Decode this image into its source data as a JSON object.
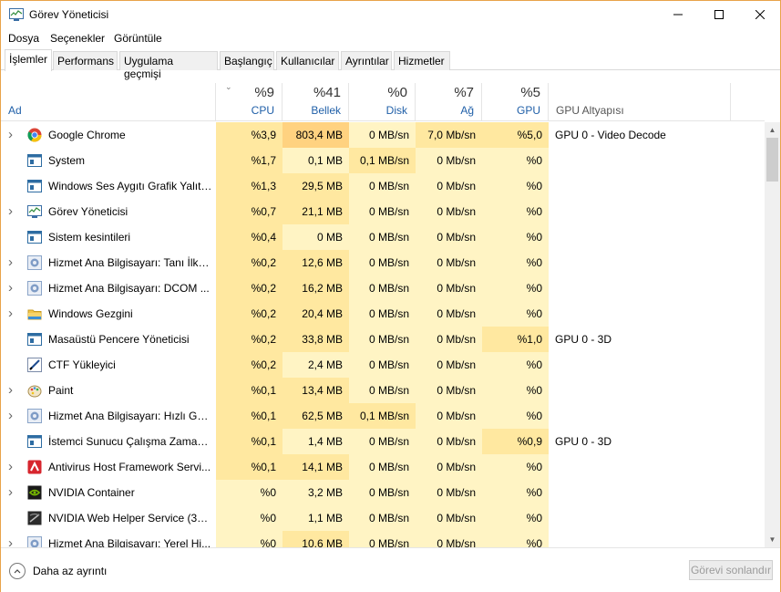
{
  "window": {
    "title": "Görev Yöneticisi"
  },
  "menu": [
    "Dosya",
    "Seçenekler",
    "Görüntüle"
  ],
  "tabs": [
    "İşlemler",
    "Performans",
    "Uygulama geçmişi",
    "Başlangıç",
    "Kullanıcılar",
    "Ayrıntılar",
    "Hizmetler"
  ],
  "header": {
    "name_label": "Ad",
    "cpu": {
      "pct": "%9",
      "label": "CPU"
    },
    "memory": {
      "pct": "%41",
      "label": "Bellek"
    },
    "disk": {
      "pct": "%0",
      "label": "Disk"
    },
    "network": {
      "pct": "%7",
      "label": "Ağ"
    },
    "gpu": {
      "pct": "%5",
      "label": "GPU"
    },
    "gpu_engine_label": "GPU Altyapısı"
  },
  "colors": {
    "heat_light": "#fff4c4",
    "heat_medium": "#ffe8a0",
    "heat_strong": "#ffd280",
    "link_blue": "#1f5fa8"
  },
  "processes": [
    {
      "name": "Google Chrome",
      "icon": "chrome-icon",
      "expandable": true,
      "cpu": "%3,9",
      "mem": "803,4 MB",
      "disk": "0 MB/sn",
      "net": "7,0 Mb/sn",
      "gpu": "%5,0",
      "engine": "GPU 0 - Video Decode"
    },
    {
      "name": "System",
      "icon": "system-window-icon",
      "expandable": false,
      "cpu": "%1,7",
      "mem": "0,1 MB",
      "disk": "0,1 MB/sn",
      "net": "0 Mb/sn",
      "gpu": "%0",
      "engine": ""
    },
    {
      "name": "Windows Ses Aygıtı Grafik Yalıtı...",
      "icon": "system-window-icon",
      "expandable": false,
      "cpu": "%1,3",
      "mem": "29,5 MB",
      "disk": "0 MB/sn",
      "net": "0 Mb/sn",
      "gpu": "%0",
      "engine": ""
    },
    {
      "name": "Görev Yöneticisi",
      "icon": "task-manager-icon",
      "expandable": true,
      "cpu": "%0,7",
      "mem": "21,1 MB",
      "disk": "0 MB/sn",
      "net": "0 Mb/sn",
      "gpu": "%0",
      "engine": ""
    },
    {
      "name": "Sistem kesintileri",
      "icon": "system-window-icon",
      "expandable": false,
      "cpu": "%0,4",
      "mem": "0 MB",
      "disk": "0 MB/sn",
      "net": "0 Mb/sn",
      "gpu": "%0",
      "engine": ""
    },
    {
      "name": "Hizmet Ana Bilgisayarı: Tanı İlke...",
      "icon": "gear-icon",
      "expandable": true,
      "cpu": "%0,2",
      "mem": "12,6 MB",
      "disk": "0 MB/sn",
      "net": "0 Mb/sn",
      "gpu": "%0",
      "engine": ""
    },
    {
      "name": "Hizmet Ana Bilgisayarı: DCOM ...",
      "icon": "gear-icon",
      "expandable": true,
      "cpu": "%0,2",
      "mem": "16,2 MB",
      "disk": "0 MB/sn",
      "net": "0 Mb/sn",
      "gpu": "%0",
      "engine": ""
    },
    {
      "name": "Windows Gezgini",
      "icon": "folder-icon",
      "expandable": true,
      "cpu": "%0,2",
      "mem": "20,4 MB",
      "disk": "0 MB/sn",
      "net": "0 Mb/sn",
      "gpu": "%0",
      "engine": ""
    },
    {
      "name": "Masaüstü Pencere Yöneticisi",
      "icon": "system-window-icon",
      "expandable": false,
      "cpu": "%0,2",
      "mem": "33,8 MB",
      "disk": "0 MB/sn",
      "net": "0 Mb/sn",
      "gpu": "%1,0",
      "engine": "GPU 0 - 3D"
    },
    {
      "name": "CTF Yükleyici",
      "icon": "pen-icon",
      "expandable": false,
      "cpu": "%0,2",
      "mem": "2,4 MB",
      "disk": "0 MB/sn",
      "net": "0 Mb/sn",
      "gpu": "%0",
      "engine": ""
    },
    {
      "name": "Paint",
      "icon": "paint-icon",
      "expandable": true,
      "cpu": "%0,1",
      "mem": "13,4 MB",
      "disk": "0 MB/sn",
      "net": "0 Mb/sn",
      "gpu": "%0",
      "engine": ""
    },
    {
      "name": "Hizmet Ana Bilgisayarı: Hızlı Get...",
      "icon": "gear-icon",
      "expandable": true,
      "cpu": "%0,1",
      "mem": "62,5 MB",
      "disk": "0,1 MB/sn",
      "net": "0 Mb/sn",
      "gpu": "%0",
      "engine": ""
    },
    {
      "name": "İstemci Sunucu Çalışma Zaman...",
      "icon": "system-window-icon",
      "expandable": false,
      "cpu": "%0,1",
      "mem": "1,4 MB",
      "disk": "0 MB/sn",
      "net": "0 Mb/sn",
      "gpu": "%0,9",
      "engine": "GPU 0 - 3D"
    },
    {
      "name": "Antivirus Host Framework Servi...",
      "icon": "antivirus-icon",
      "expandable": true,
      "cpu": "%0,1",
      "mem": "14,1 MB",
      "disk": "0 MB/sn",
      "net": "0 Mb/sn",
      "gpu": "%0",
      "engine": ""
    },
    {
      "name": "NVIDIA Container",
      "icon": "nvidia-icon",
      "expandable": true,
      "cpu": "%0",
      "mem": "3,2 MB",
      "disk": "0 MB/sn",
      "net": "0 Mb/sn",
      "gpu": "%0",
      "engine": ""
    },
    {
      "name": "NVIDIA Web Helper Service (32 ...",
      "icon": "nvidia-web-icon",
      "expandable": false,
      "cpu": "%0",
      "mem": "1,1 MB",
      "disk": "0 MB/sn",
      "net": "0 Mb/sn",
      "gpu": "%0",
      "engine": ""
    },
    {
      "name": "Hizmet Ana Bilgisayarı: Yerel Hi...",
      "icon": "gear-icon",
      "expandable": true,
      "cpu": "%0",
      "mem": "10,6 MB",
      "disk": "0 MB/sn",
      "net": "0 Mb/sn",
      "gpu": "%0",
      "engine": ""
    }
  ],
  "footer": {
    "less_details_label": "Daha az ayrıntı",
    "end_task_label": "Görevi sonlandır"
  }
}
